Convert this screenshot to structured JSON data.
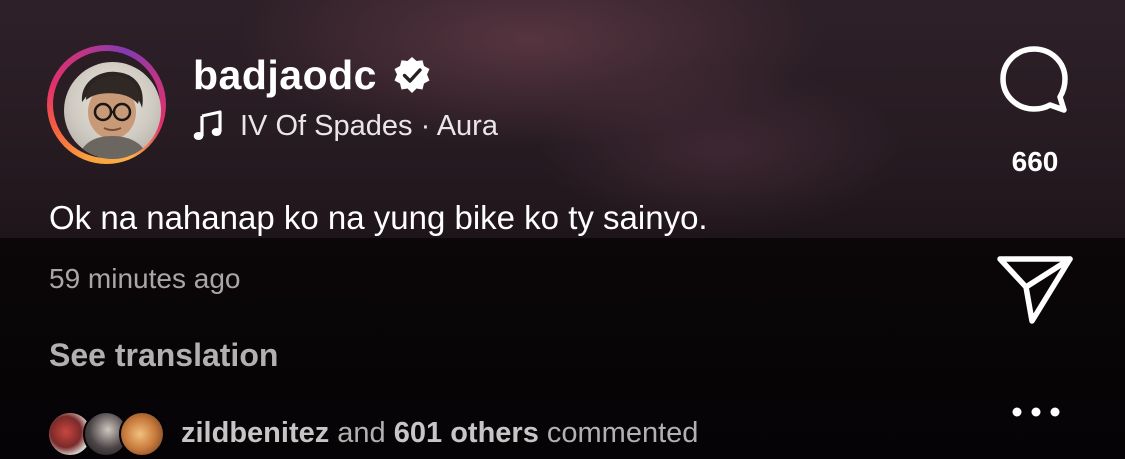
{
  "post": {
    "username": "badjaodc",
    "verified": true,
    "audio": {
      "artist": "IV Of Spades",
      "separator": "·",
      "track": "Aura"
    },
    "caption": "Ok na nahanap ko na yung bike ko ty sainyo.",
    "timestamp": "59 minutes ago",
    "see_translation": "See translation"
  },
  "actions": {
    "comment_icon": "comment-bubble-icon",
    "comment_count": "660",
    "share_icon": "paper-plane-icon",
    "more_icon": "more-dots-icon"
  },
  "comments_summary": {
    "first_commenter": "zildbenitez",
    "connector": "and",
    "others": "601 others",
    "suffix": "commented"
  },
  "colors": {
    "text_primary": "#ffffff",
    "text_secondary": "#a9a6a8",
    "story_ring": [
      "#fcaf45",
      "#f56040",
      "#e1306c",
      "#c13584",
      "#833ab4"
    ]
  }
}
